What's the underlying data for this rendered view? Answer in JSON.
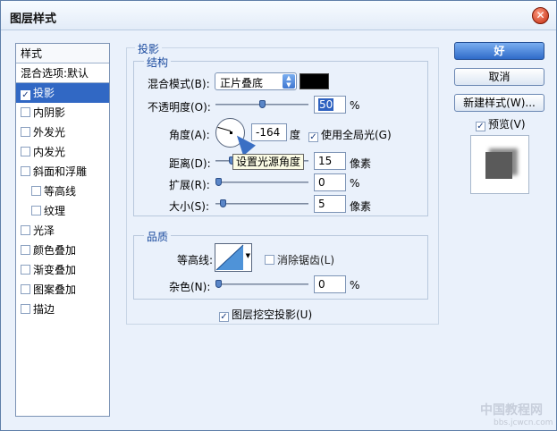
{
  "window": {
    "title": "图层样式",
    "close_glyph": "✕"
  },
  "sidebar": {
    "header": "样式",
    "blend": "混合选项:默认",
    "items": [
      {
        "label": "投影",
        "checked": true,
        "selected": true
      },
      {
        "label": "内阴影"
      },
      {
        "label": "外发光"
      },
      {
        "label": "内发光"
      },
      {
        "label": "斜面和浮雕"
      },
      {
        "label": "等高线",
        "sub": true
      },
      {
        "label": "纹理",
        "sub": true
      },
      {
        "label": "光泽"
      },
      {
        "label": "颜色叠加"
      },
      {
        "label": "渐变叠加"
      },
      {
        "label": "图案叠加"
      },
      {
        "label": "描边"
      }
    ]
  },
  "check_glyph": "✓",
  "drop_shadow": {
    "legend": "投影",
    "structure": {
      "legend": "结构",
      "blend_mode_label": "混合模式(B):",
      "blend_mode_value": "正片叠底",
      "blend_color": "#000000",
      "opacity_label": "不透明度(O):",
      "opacity_value": "50",
      "opacity_unit": "%",
      "angle_label": "角度(A):",
      "angle_value": "-164",
      "angle_unit": "度",
      "global_light_label": "使用全局光(G)",
      "global_light_checked": true,
      "distance_label": "距离(D):",
      "distance_value": "15",
      "distance_unit": "像素",
      "spread_label": "扩展(R):",
      "spread_value": "0",
      "spread_unit": "%",
      "size_label": "大小(S):",
      "size_value": "5",
      "size_unit": "像素",
      "tooltip": "设置光源角度"
    },
    "quality": {
      "legend": "品质",
      "contour_label": "等高线:",
      "antialias_label": "消除锯齿(L)",
      "antialias_checked": false,
      "noise_label": "杂色(N):",
      "noise_value": "0",
      "noise_unit": "%"
    },
    "knockout_label": "图层挖空投影(U)",
    "knockout_checked": true
  },
  "buttons": {
    "ok": "好",
    "cancel": "取消",
    "new_style": "新建样式(W)...",
    "preview_label": "预览(V)",
    "preview_checked": true
  },
  "watermark": {
    "line1": "中国教程网",
    "line2": "bbs.jcwcn.com"
  },
  "sliders": {
    "opacity": 0.5,
    "distance": 0.15,
    "spread": 0.0,
    "size": 0.05,
    "noise": 0.0
  }
}
